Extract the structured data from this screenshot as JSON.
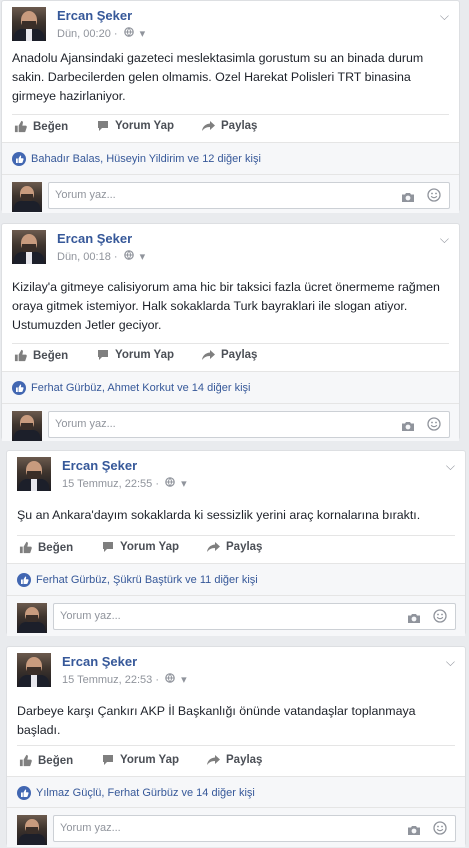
{
  "posts": [
    {
      "author": "Ercan Şeker",
      "time": "Dün, 00:20",
      "text": "Anadolu Ajansindaki gazeteci meslektasimla gorustum su an binada durum sakin. Darbecilerden gelen olmamis. Ozel Harekat Polisleri TRT binasina girmeye hazirlaniyor.",
      "likes": "Bahadır Balas, Hüseyin Yildirim ve 12 diğer kişi"
    },
    {
      "author": "Ercan Şeker",
      "time": "Dün, 00:18",
      "text": "Kizilay'a gitmeye calisiyorum ama hic bir taksici fazla ücret önermeme rağmen oraya gitmek istemiyor. Halk sokaklarda Turk bayraklari ile slogan atiyor. Ustumuzden Jetler geciyor.",
      "likes": "Ferhat Gürbüz, Ahmet Korkut ve 14 diğer kişi"
    },
    {
      "author": "Ercan Şeker",
      "time": "15 Temmuz, 22:55",
      "text": "Şu an Ankara'dayım sokaklarda ki sessizlik yerini araç kornalarına bıraktı.",
      "likes": "Ferhat Gürbüz, Şükrü Baştürk ve 11 diğer kişi"
    },
    {
      "author": "Ercan Şeker",
      "time": "15 Temmuz, 22:53",
      "text": "Darbeye karşı Çankırı AKP İl Başkanlığı önünde vatandaşlar toplanmaya başladı.",
      "likes": "Yılmaz Güçlü, Ferhat Gürbüz ve 14 diğer kişi"
    }
  ],
  "actions": {
    "like": "Beğen",
    "comment": "Yorum Yap",
    "share": "Paylaş"
  },
  "comment_placeholder": "Yorum yaz...",
  "icons": {
    "privacy": "globe-icon",
    "menu": "chevron-down-icon",
    "like": "thumbs-up-icon",
    "comment": "speech-bubble-icon",
    "share": "share-arrow-icon",
    "camera": "camera-icon",
    "emoji": "smiley-icon"
  },
  "colors": {
    "link": "#365899",
    "accent": "#4267b2",
    "meta": "#90949c",
    "background": "#e9ebee"
  }
}
